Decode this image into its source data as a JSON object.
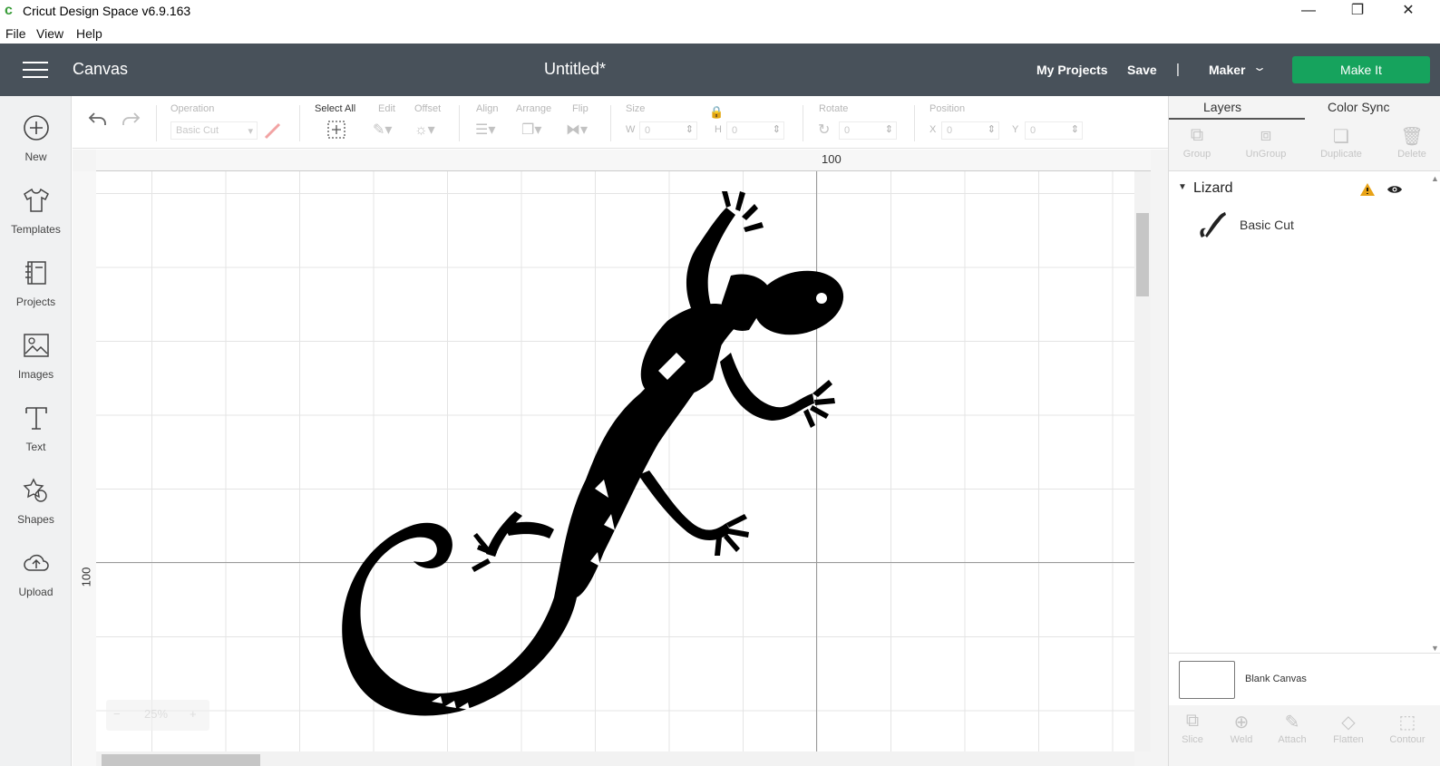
{
  "app": {
    "title": "Cricut Design Space  v6.9.163"
  },
  "window": {
    "minimize": "—",
    "restore": "❐",
    "close": "✕"
  },
  "menu": [
    "File",
    "View",
    "Help"
  ],
  "header": {
    "section": "Canvas",
    "document_title": "Untitled*",
    "my_projects": "My Projects",
    "save": "Save",
    "separator": "|",
    "machine": "Maker",
    "make_it": "Make It",
    "make_it_color": "#16a35d",
    "bar_color": "#48515a"
  },
  "sidebar": {
    "items": [
      {
        "label": "New",
        "icon": "plus-circle-icon"
      },
      {
        "label": "Templates",
        "icon": "shirt-icon"
      },
      {
        "label": "Projects",
        "icon": "book-icon"
      },
      {
        "label": "Images",
        "icon": "image-icon"
      },
      {
        "label": "Text",
        "icon": "text-icon"
      },
      {
        "label": "Shapes",
        "icon": "shapes-icon"
      },
      {
        "label": "Upload",
        "icon": "cloud-upload-icon"
      }
    ]
  },
  "toolbar": {
    "operation_label": "Operation",
    "operation_value": "Basic Cut",
    "select_all": "Select All",
    "edit": "Edit",
    "offset": "Offset",
    "align": "Align",
    "arrange": "Arrange",
    "flip": "Flip",
    "size": "Size",
    "w": "W",
    "w_value": "0",
    "h": "H",
    "h_value": "0",
    "rotate": "Rotate",
    "rotate_value": "0",
    "position": "Position",
    "x": "X",
    "x_value": "0",
    "y": "Y",
    "y_value": "0"
  },
  "canvas": {
    "ruler_top_label": "100",
    "ruler_left_label": "100",
    "zoom_minus": "−",
    "zoom_value": "25%",
    "zoom_plus": "+"
  },
  "panel": {
    "tabs": [
      "Layers",
      "Color Sync"
    ],
    "actions": [
      "Group",
      "UnGroup",
      "Duplicate",
      "Delete"
    ],
    "layer_group_name": "Lizard",
    "layer_item_name": "Basic Cut",
    "warning_color": "#e8a317",
    "blank_canvas": "Blank Canvas",
    "bottom_actions": [
      "Slice",
      "Weld",
      "Attach",
      "Flatten",
      "Contour"
    ]
  }
}
